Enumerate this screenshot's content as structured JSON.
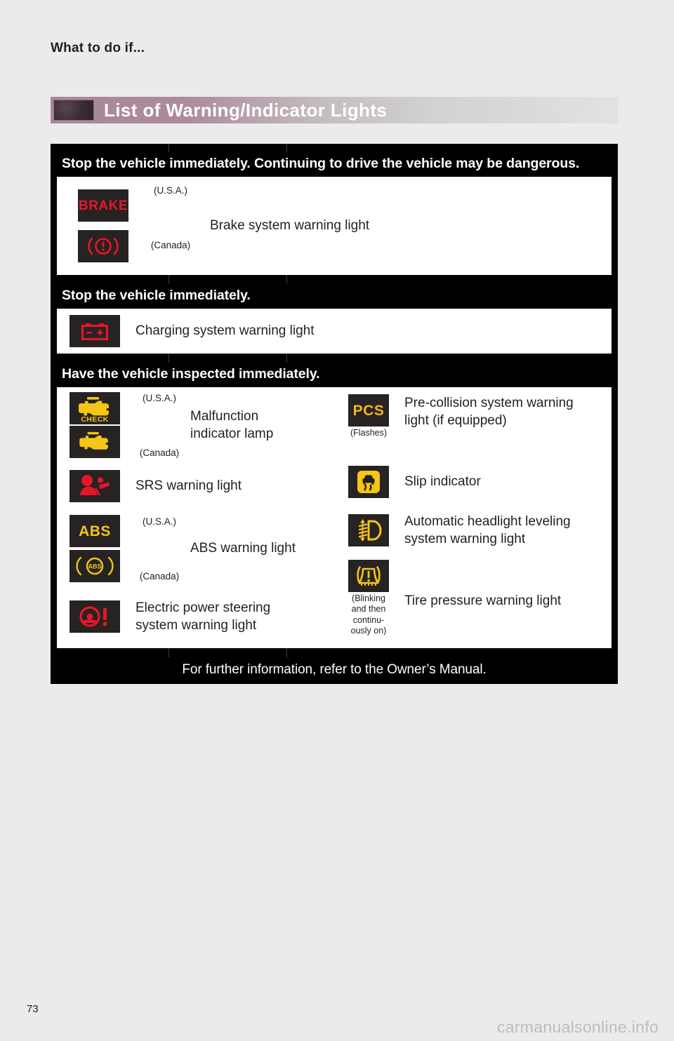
{
  "page": {
    "running_head": "What to do if...",
    "page_number": "73",
    "watermark": "carmanualsonline.info"
  },
  "banner": {
    "title": "List of Warning/Indicator Lights",
    "chip_icon": "section-marker",
    "accent_color": "#a9879a"
  },
  "table": {
    "footer_note": "For further information, refer to the Owner’s Manual.",
    "sections": [
      {
        "heading": "Stop the vehicle immediately. Continuing to drive the vehicle may be dangerous.",
        "entries": [
          {
            "icon": "brake-text-icon",
            "icon_label": "BRAKE",
            "icon_color": "#e8152a",
            "region_a": "(U.S.A.)",
            "region_b": "(Canada)",
            "icon_b": "brake-circle-exclamation-icon",
            "description": "Brake system warning light"
          }
        ]
      },
      {
        "heading": "Stop the vehicle immediately.",
        "entries": [
          {
            "icon": "battery-icon",
            "icon_color": "#e8152a",
            "description": "Charging system warning light"
          }
        ]
      },
      {
        "heading": "Have the vehicle inspected immediately.",
        "left_entries": [
          {
            "icon": "check-engine-check-icon",
            "icon_label": "CHECK",
            "icon_color": "#f5c518",
            "region_a": "(U.S.A.)",
            "region_b": "(Canada)",
            "icon_b": "check-engine-icon",
            "description_line1": "Malfunction",
            "description_line2": "indicator lamp"
          },
          {
            "icon": "srs-airbag-icon",
            "icon_color": "#e8152a",
            "description": "SRS warning light"
          },
          {
            "icon": "abs-text-icon",
            "icon_label": "ABS",
            "icon_color": "#f5c518",
            "region_a": "(U.S.A.)",
            "region_b": "(Canada)",
            "icon_b": "abs-circle-icon",
            "icon_b_label": "ABS",
            "description": "ABS warning light"
          },
          {
            "icon": "steering-wheel-exclamation-icon",
            "icon_color": "#e8152a",
            "description_line1": "Electric power steering",
            "description_line2": "system warning light"
          }
        ],
        "right_entries": [
          {
            "icon": "pcs-text-icon",
            "icon_label": "PCS",
            "icon_color": "#f5b716",
            "note": "(Flashes)",
            "description_line1": "Pre-collision system warning",
            "description_line2": "light (if equipped)"
          },
          {
            "icon": "slip-indicator-icon",
            "icon_color": "#f5c518",
            "description": "Slip indicator"
          },
          {
            "icon": "headlight-leveling-icon",
            "icon_color": "#f5c518",
            "description_line1": "Automatic headlight leveling",
            "description_line2": "system warning light"
          },
          {
            "icon": "tire-pressure-icon",
            "icon_color": "#f5c518",
            "note_line1": "(Blinking",
            "note_line2": "and then",
            "note_line3": "continu-",
            "note_line4": "ously on)",
            "description": "Tire pressure warning light"
          }
        ]
      }
    ]
  }
}
